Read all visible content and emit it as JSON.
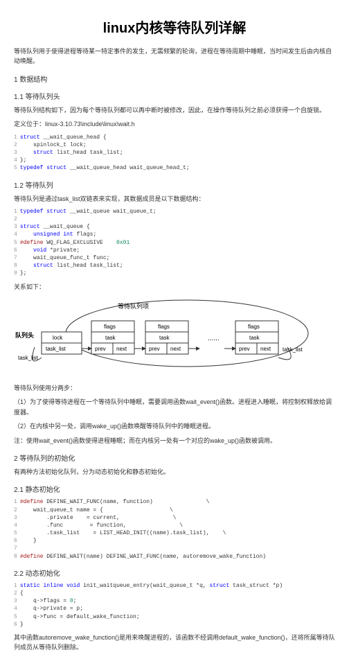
{
  "title": "linux内核等待队列详解",
  "intro": "等待队列用于使得进程等待某一特定事件的发生，无需频繁的轮询，进程在等待周期中睡眠，当时间发生后由内核自动唤醒。",
  "s1": {
    "h": "1 数据结构"
  },
  "s1_1": {
    "h": "1.1 等待队列头",
    "p1": "等待队列结构如下，因为每个等待队列都可以再中断时被修改，因此，在操作等待队列之前必须获得一个自旋锁。",
    "p2": "定义位于：linux-3.10.73\\include\\linux\\wait.h",
    "code": [
      {
        "n": "1",
        "t": "struct __wait_queue_head {",
        "cls": "kw-struct"
      },
      {
        "n": "2",
        "t": "    spinlock_t lock;"
      },
      {
        "n": "3",
        "t": "    struct list_head task_list;",
        "cls": "kw-struct"
      },
      {
        "n": "4",
        "t": "};"
      },
      {
        "n": "5",
        "t": "typedef struct __wait_queue_head wait_queue_head_t;",
        "cls": "kw-typedef"
      }
    ]
  },
  "s1_2": {
    "h": "1.2 等待队列",
    "p1": "等待队列是通过task_list双链表来实现，其数据成员是以下数据结构：",
    "code": [
      {
        "n": "1",
        "t": "typedef struct __wait_queue wait_queue_t;",
        "cls": "kw-typedef"
      },
      {
        "n": "2",
        "t": ""
      },
      {
        "n": "3",
        "t": "struct __wait_queue {",
        "cls": "kw-struct"
      },
      {
        "n": "4",
        "t": "    unsigned int flags;",
        "cls": "kw-int"
      },
      {
        "n": "5",
        "t": "#define WQ_FLAG_EXCLUSIVE    0x01",
        "cls": "kw-define"
      },
      {
        "n": "6",
        "t": "    void *private;",
        "cls": "kw-void"
      },
      {
        "n": "7",
        "t": "    wait_queue_func_t func;"
      },
      {
        "n": "8",
        "t": "    struct list_head task_list;",
        "cls": "kw-struct"
      },
      {
        "n": "9",
        "t": "};"
      }
    ],
    "rel": "关系如下：",
    "diagram": {
      "label_top": "等待队列项",
      "label_left": "队列头",
      "box1": {
        "r1": "lock",
        "r2": "task_list"
      },
      "box_items": [
        {
          "r1": "flags",
          "r2": "task",
          "r3a": "prev",
          "r3b": "next"
        },
        {
          "r1": "flags",
          "r2": "task",
          "r3a": "prev",
          "r3b": "next"
        },
        {
          "r1": "flags",
          "r2": "task",
          "r3a": "prev",
          "r3b": "next"
        }
      ],
      "tasklist_l": "task_list",
      "tasklist_r": "task_list",
      "dots": "......"
    },
    "p2": "等待队列使用分两步：",
    "li1": "（1）为了使得等待进程在一个等待队列中睡眠，需要调用函数wait_event()函数。进程进入睡眠，将控制权释放给调度器。",
    "li2": "（2）在内核中另一处，调用wake_up()函数唤醒等待队列中的睡眠进程。",
    "note": "注：使用wait_event()函数使得进程睡眠；而在内核另一处有一个对应的wake_up()函数被调用。"
  },
  "s2": {
    "h": "2 等待队列的初始化",
    "p": "有两种方法初始化队列，分为动态初始化和静态初始化。"
  },
  "s2_1": {
    "h": "2.1 静态初始化",
    "code": [
      {
        "n": "1",
        "t": "#define DEFINE_WAIT_FUNC(name, function)                \\",
        "cls": "kw-define"
      },
      {
        "n": "2",
        "t": "    wait_queue_t name = {                    \\"
      },
      {
        "n": "3",
        "t": "        .private    = current,                \\"
      },
      {
        "n": "4",
        "t": "        .func        = function,                \\"
      },
      {
        "n": "5",
        "t": "        .task_list    = LIST_HEAD_INIT((name).task_list),    \\"
      },
      {
        "n": "6",
        "t": "    }"
      },
      {
        "n": "7",
        "t": ""
      },
      {
        "n": "8",
        "t": "#define DEFINE_WAIT(name) DEFINE_WAIT_FUNC(name, autoremove_wake_function)",
        "cls": "kw-define"
      }
    ]
  },
  "s2_2": {
    "h": "2.2 动态初始化",
    "code": [
      {
        "n": "1",
        "t": "static inline void init_waitqueue_entry(wait_queue_t *q, struct task_struct *p)",
        "cls": "kw-static"
      },
      {
        "n": "2",
        "t": "{"
      },
      {
        "n": "3",
        "t": "    q->flags = 0;",
        "num": "0"
      },
      {
        "n": "4",
        "t": "    q->private = p;"
      },
      {
        "n": "5",
        "t": "    q->func = default_wake_function;"
      },
      {
        "n": "6",
        "t": "}"
      }
    ],
    "p": "其中函数autoremove_wake_function()是用来唤醒进程的，该函数不经调用default_wake_function()，还将所属等待队列成员从等待队列删除。"
  }
}
